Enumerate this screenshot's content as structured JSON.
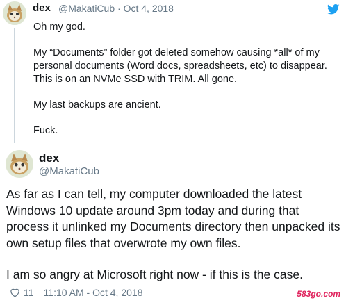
{
  "tweet1": {
    "name": "dex",
    "handle": "@MakatiCub",
    "sep": "·",
    "date": "Oct 4, 2018",
    "paragraphs": [
      "Oh my god.",
      "My “Documents” folder got deleted somehow causing *all* of my personal documents (Word docs, spreadsheets, etc) to disappear. This is on an NVMe SSD with TRIM. All gone.",
      "My last backups are ancient.",
      "Fuck."
    ]
  },
  "tweet2": {
    "name": "dex",
    "handle": "@MakatiCub",
    "paragraphs": [
      "As far as I can tell, my computer downloaded the latest Windows 10 update around 3pm today and during that process it unlinked my Documents directory then unpacked its own setup files that overwrote my own files.",
      "I am so angry at Microsoft right now - if this is the case."
    ],
    "likes": "11",
    "timestamp": "11:10 AM - Oct 4, 2018"
  },
  "watermark": "583go.com",
  "colors": {
    "twitter_blue": "#1da1f2",
    "muted": "#657786"
  }
}
